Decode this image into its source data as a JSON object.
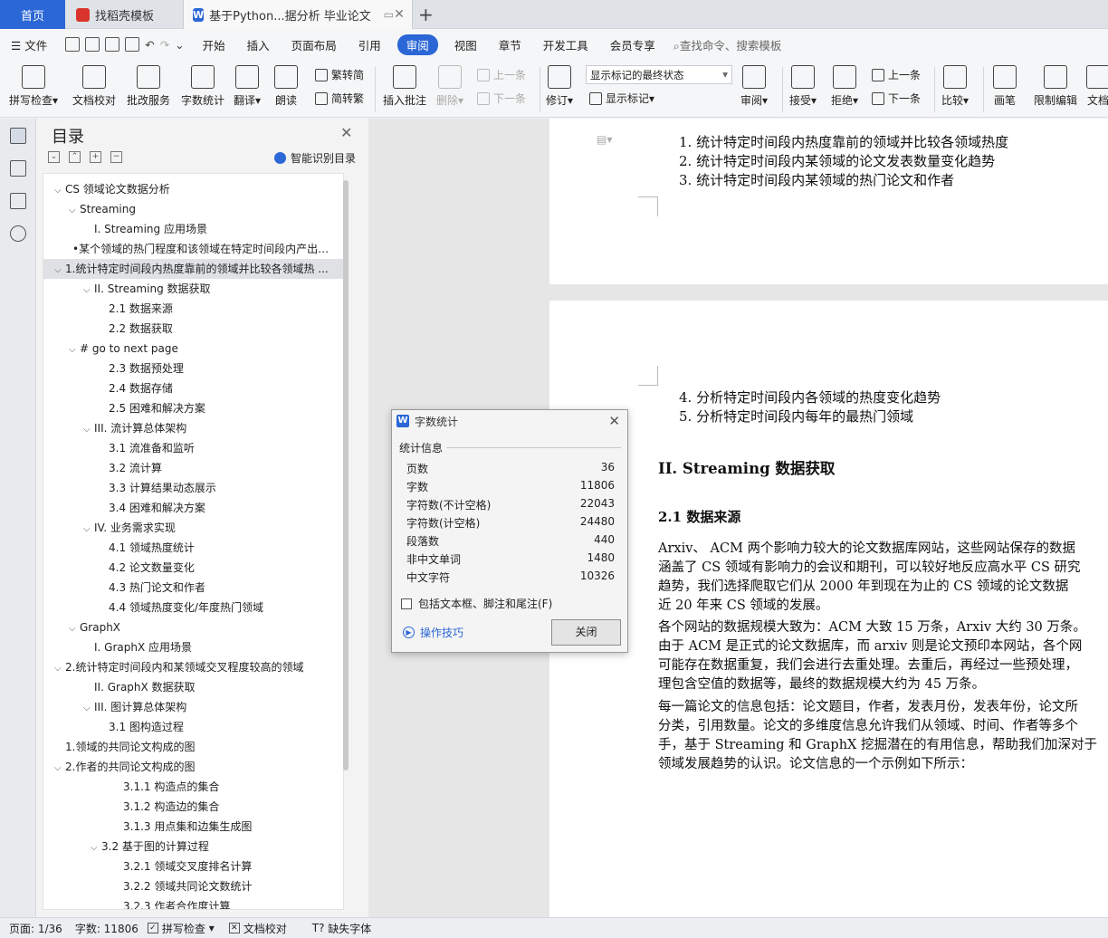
{
  "tabs": {
    "home": "首页",
    "template": "找稻壳模板",
    "doc": "基于Python...据分析 毕业论文"
  },
  "menu": {
    "file": "文件",
    "items": [
      "开始",
      "插入",
      "页面布局",
      "引用",
      "审阅",
      "视图",
      "章节",
      "开发工具",
      "会员专享"
    ],
    "active": "审阅",
    "search": "查找命令、搜索模板"
  },
  "ribbon": {
    "spell": "拼写检查",
    "doc_check": "文档校对",
    "annot": "批改服务",
    "wordcount": "字数统计",
    "translate": "翻译",
    "read": "朗读",
    "trad": "繁转简",
    "simp": "简转繁",
    "insert_comment": "插入批注",
    "delete": "删除",
    "prev": "上一条",
    "next": "下一条",
    "revise": "修订",
    "mark_state": "显示标记的最终状态",
    "show_mark": "显示标记",
    "review": "审阅",
    "accept": "接受",
    "reject": "拒绝",
    "prev2": "上一条",
    "next2": "下一条",
    "compare": "比较",
    "pen": "画笔",
    "restrict": "限制编辑",
    "doc_right": "文档"
  },
  "nav": {
    "title": "目录",
    "smart": "智能识别目录",
    "toc": [
      {
        "text": "CS 领域论文数据分析",
        "caret": "⌵"
      },
      {
        "text": "Streaming",
        "caret": "⌵"
      },
      {
        "text": "I. Streaming 应用场景",
        "caret": ""
      },
      {
        "text": "•某个领域的热门程度和该领域在特定时间段内产出的 ...",
        "caret": ""
      },
      {
        "text": "1.统计特定时间段内热度靠前的领域并比较各领域热 ...",
        "caret": "⌵"
      },
      {
        "text": "II. Streaming 数据获取",
        "caret": "⌵"
      },
      {
        "text": "2.1  数据来源",
        "caret": ""
      },
      {
        "text": "2.2  数据获取",
        "caret": ""
      },
      {
        "text": "# go to next page",
        "caret": "⌵"
      },
      {
        "text": "2.3  数据预处理",
        "caret": ""
      },
      {
        "text": "2.4  数据存储",
        "caret": ""
      },
      {
        "text": "2.5  困难和解决方案",
        "caret": ""
      },
      {
        "text": "III. 流计算总体架构",
        "caret": "⌵"
      },
      {
        "text": "3.1  流准备和监听",
        "caret": ""
      },
      {
        "text": "3.2  流计算",
        "caret": ""
      },
      {
        "text": "3.3  计算结果动态展示",
        "caret": ""
      },
      {
        "text": "3.4  困难和解决方案",
        "caret": ""
      },
      {
        "text": "IV.  业务需求实现",
        "caret": "⌵"
      },
      {
        "text": "4.1  领域热度统计",
        "caret": ""
      },
      {
        "text": "4.2  论文数量变化",
        "caret": ""
      },
      {
        "text": "4.3  热门论文和作者",
        "caret": ""
      },
      {
        "text": "4.4  领域热度变化/年度热门领域",
        "caret": ""
      },
      {
        "text": "GraphX",
        "caret": "⌵"
      },
      {
        "text": "I. GraphX 应用场景",
        "caret": ""
      },
      {
        "text": "2.统计特定时间段内和某领域交叉程度较高的领域",
        "caret": "⌵"
      },
      {
        "text": "II. GraphX 数据获取",
        "caret": ""
      },
      {
        "text": "III. 图计算总体架构",
        "caret": "⌵"
      },
      {
        "text": "3.1  图构造过程",
        "caret": ""
      },
      {
        "text": "1.领域的共同论文构成的图",
        "caret": ""
      },
      {
        "text": "2.作者的共同论文构成的图",
        "caret": "⌵"
      },
      {
        "text": "3.1.1  构造点的集合",
        "caret": ""
      },
      {
        "text": "3.1.2  构造边的集合",
        "caret": ""
      },
      {
        "text": "3.1.3  用点集和边集生成图",
        "caret": ""
      },
      {
        "text": "3.2  基于图的计算过程",
        "caret": "⌵"
      },
      {
        "text": "3.2.1  领域交叉度排名计算",
        "caret": ""
      },
      {
        "text": "3.2.2  领域共同论文数统计",
        "caret": ""
      },
      {
        "text": "3.2.3  作者合作度计算",
        "caret": ""
      }
    ]
  },
  "document": {
    "list_a": [
      "1.   统计特定时间段内热度靠前的领域并比较各领域热度",
      "2.   统计特定时间段内某领域的论文发表数量变化趋势",
      "3.   统计特定时间段内某领域的热门论文和作者"
    ],
    "list_b": [
      "4.   分析特定时间段内各领域的热度变化趋势",
      "5.   分析特定时间段内每年的最热门领域"
    ],
    "heading": "II. Streaming 数据获取",
    "subheading": "2.1  数据来源",
    "para1": [
      "Arxiv、 ACM 两个影响力较大的论文数据库网站，这些网站保存的数据",
      "涵盖了 CS 领域有影响力的会议和期刊，可以较好地反应高水平 CS 研究",
      "趋势，我们选择爬取它们从 2000 年到现在为止的 CS 领域的论文数据",
      "近 20 年来 CS 领域的发展。"
    ],
    "para2": [
      "各个网站的数据规模大致为：ACM 大致 15 万条，Arxiv 大约 30 万条。",
      "由于 ACM 是正式的论文数据库，而 arxiv 则是论文预印本网站，各个网",
      "可能存在数据重复，我们会进行去重处理。去重后，再经过一些预处理，",
      "理包含空值的数据等，最终的数据规模大约为 45 万条。"
    ],
    "para3": [
      "每一篇论文的信息包括：论文题目，作者，发表月份，发表年份，论文所",
      "分类，引用数量。论文的多维度信息允许我们从领域、时间、作者等多个",
      "手，基于 Streaming 和 GraphX 挖掘潜在的有用信息，帮助我们加深对于",
      "领域发展趋势的认识。论文信息的一个示例如下所示："
    ]
  },
  "dialog": {
    "title": "字数统计",
    "section": "统计信息",
    "rows": [
      {
        "label": "页数",
        "value": "36"
      },
      {
        "label": "字数",
        "value": "11806"
      },
      {
        "label": "字符数(不计空格)",
        "value": "22043"
      },
      {
        "label": "字符数(计空格)",
        "value": "24480"
      },
      {
        "label": "段落数",
        "value": "440"
      },
      {
        "label": "非中文单词",
        "value": "1480"
      },
      {
        "label": "中文字符",
        "value": "10326"
      }
    ],
    "checkbox": "包括文本框、脚注和尾注(F)",
    "tips": "操作技巧",
    "close": "关闭"
  },
  "status": {
    "page": "页面: 1/36",
    "words": "字数: 11806",
    "spell": "拼写检查",
    "doc_check": "文档校对",
    "missing_font": "缺失字体"
  }
}
